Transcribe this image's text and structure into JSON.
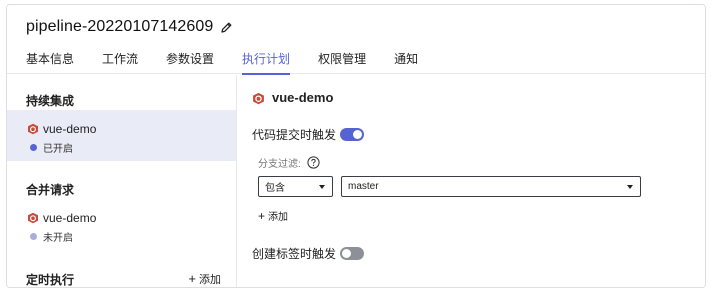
{
  "header": {
    "title": "pipeline-20220107142609",
    "tabs": [
      {
        "label": "基本信息"
      },
      {
        "label": "工作流"
      },
      {
        "label": "参数设置"
      },
      {
        "label": "执行计划"
      },
      {
        "label": "权限管理"
      },
      {
        "label": "通知"
      }
    ],
    "active_tab": "执行计划"
  },
  "sidebar": {
    "ci": {
      "title": "持续集成",
      "item": {
        "name": "vue-demo",
        "status": "已开启"
      }
    },
    "merge": {
      "title": "合并请求",
      "item": {
        "name": "vue-demo",
        "status": "未开启"
      }
    },
    "schedule": {
      "title": "定时执行",
      "add_label": "添加"
    }
  },
  "main": {
    "repo_name": "vue-demo",
    "commit_trigger_label": "代码提交时触发",
    "commit_trigger_enabled": true,
    "branch_filter_label": "分支过滤:",
    "match_mode": "包含",
    "branch_value": "master",
    "add_label": "添加",
    "tag_trigger_label": "创建标签时触发",
    "tag_trigger_enabled": false
  },
  "colors": {
    "accent": "#5664d2",
    "selected_bg": "#e9ebf6",
    "toggle_off": "#8e9097",
    "dot_off": "#a9afd6"
  }
}
